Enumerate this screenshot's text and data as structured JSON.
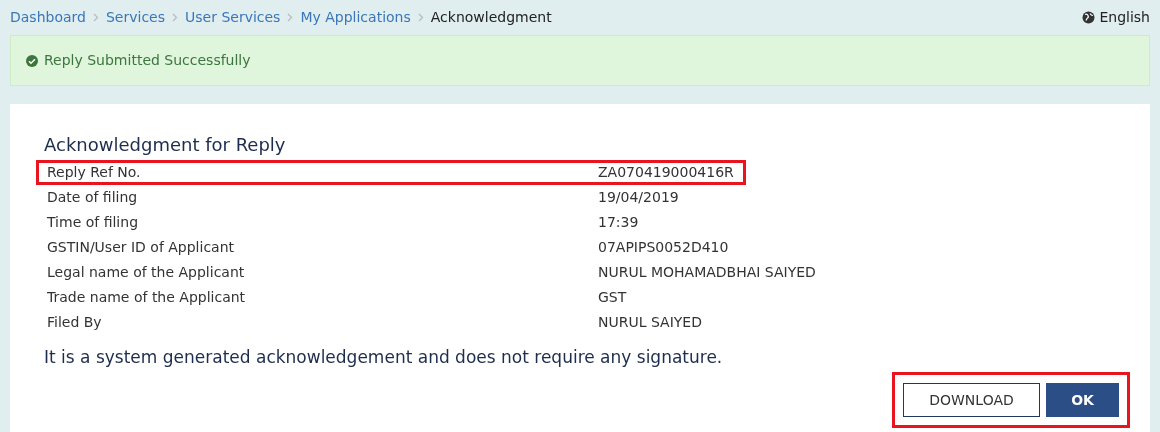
{
  "breadcrumbs": [
    {
      "label": "Dashboard",
      "current": false
    },
    {
      "label": "Services",
      "current": false
    },
    {
      "label": "User Services",
      "current": false
    },
    {
      "label": "My Applications",
      "current": false
    },
    {
      "label": "Acknowledgment",
      "current": true
    }
  ],
  "language": "English",
  "alert": {
    "message": "Reply Submitted Successfully"
  },
  "card": {
    "title": "Acknowledgment for Reply",
    "rows": [
      {
        "label": "Reply Ref No.",
        "value": "ZA070419000416R",
        "highlighted": true
      },
      {
        "label": "Date of filing",
        "value": "19/04/2019",
        "highlighted": false
      },
      {
        "label": "Time of filing",
        "value": "17:39",
        "highlighted": false
      },
      {
        "label": "GSTIN/User ID of Applicant",
        "value": "07APIPS0052D410",
        "highlighted": false
      },
      {
        "label": "Legal name of the Applicant",
        "value": "NURUL MOHAMADBHAI SAIYED",
        "highlighted": false
      },
      {
        "label": "Trade name of the Applicant",
        "value": "GST",
        "highlighted": false
      },
      {
        "label": "Filed By",
        "value": "NURUL SAIYED",
        "highlighted": false
      }
    ],
    "note": "It is a system generated acknowledgement and does not require any signature.",
    "buttons_highlighted": true,
    "buttons": [
      {
        "label": "DOWNLOAD",
        "kind": "secondary"
      },
      {
        "label": "OK",
        "kind": "primary"
      }
    ]
  }
}
